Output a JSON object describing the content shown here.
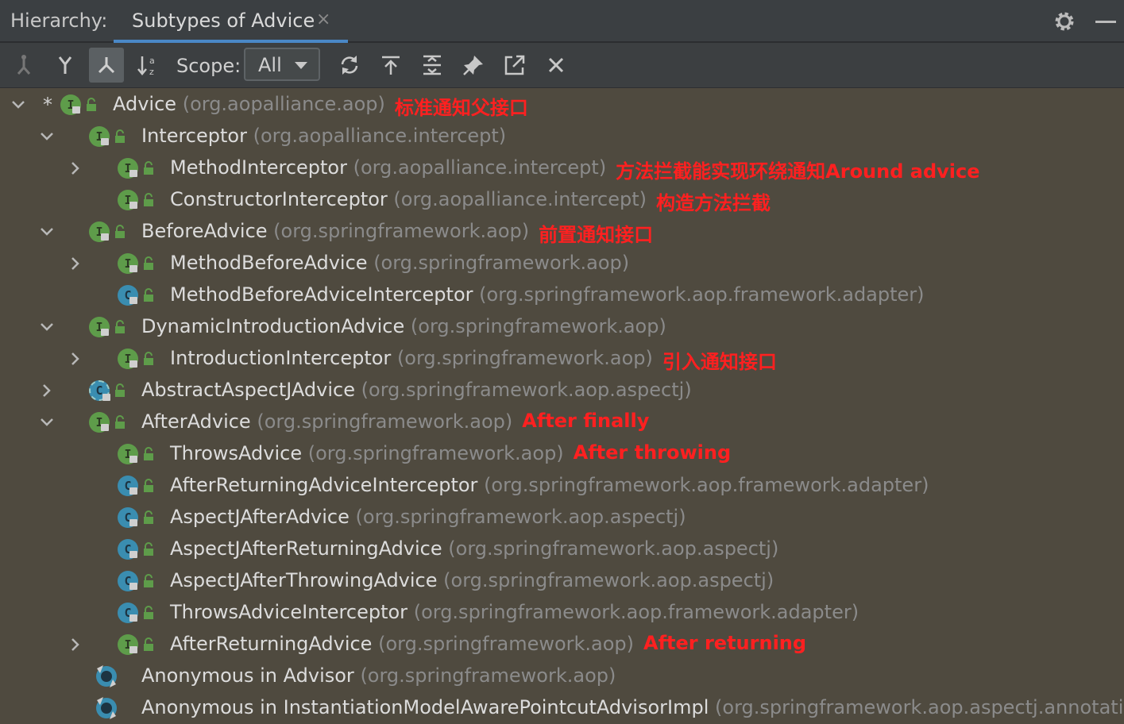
{
  "header": {
    "label": "Hierarchy:",
    "tab_title": "Subtypes of Advice",
    "tab_close": "×",
    "icons": [
      "gear-icon",
      "minimize-icon"
    ]
  },
  "toolbar": {
    "scope_label": "Scope:",
    "scope_value": "All",
    "icons": [
      "supertypes-hierarchy-icon",
      "subtypes-hierarchy-icon",
      "class-hierarchy-icon",
      "sort-alphabetically-icon",
      "refresh-icon",
      "export-icon",
      "expand-all-icon",
      "pin-icon",
      "open-in-new-window-icon",
      "close-icon"
    ]
  },
  "colors": {
    "background": "#4f4a3f",
    "annotation": "#ff2020",
    "interface": "#5e9c4a",
    "class": "#3a8db0",
    "tab_underline": "#4a88c7"
  },
  "tree": [
    {
      "name": "Advice",
      "package": "(org.aopalliance.aop)",
      "note": "标准通知父接口",
      "kind": "I",
      "star": "*",
      "chevron": "down"
    },
    {
      "name": "Interceptor",
      "package": "(org.aopalliance.intercept)",
      "note": "",
      "kind": "I",
      "chevron": "down"
    },
    {
      "name": "MethodInterceptor",
      "package": "(org.aopalliance.intercept)",
      "note": "方法拦截能实现环绕通知Around advice",
      "kind": "I",
      "chevron": "right"
    },
    {
      "name": "ConstructorInterceptor",
      "package": "(org.aopalliance.intercept)",
      "note": "构造方法拦截",
      "kind": "I",
      "chevron": ""
    },
    {
      "name": "BeforeAdvice",
      "package": "(org.springframework.aop)",
      "note": "前置通知接口",
      "kind": "I",
      "chevron": "down"
    },
    {
      "name": "MethodBeforeAdvice",
      "package": "(org.springframework.aop)",
      "note": "",
      "kind": "I",
      "chevron": "right"
    },
    {
      "name": "MethodBeforeAdviceInterceptor",
      "package": "(org.springframework.aop.framework.adapter)",
      "note": "",
      "kind": "C",
      "chevron": ""
    },
    {
      "name": "DynamicIntroductionAdvice",
      "package": "(org.springframework.aop)",
      "note": "",
      "kind": "I",
      "chevron": "down"
    },
    {
      "name": "IntroductionInterceptor",
      "package": "(org.springframework.aop)",
      "note": "引入通知接口",
      "kind": "I",
      "chevron": "right"
    },
    {
      "name": "AbstractAspectJAdvice",
      "package": "(org.springframework.aop.aspectj)",
      "note": "",
      "kind": "CA",
      "chevron": "right"
    },
    {
      "name": "AfterAdvice",
      "package": "(org.springframework.aop)",
      "note": "After finally",
      "kind": "I",
      "chevron": "down"
    },
    {
      "name": "ThrowsAdvice",
      "package": "(org.springframework.aop)",
      "note": "After throwing",
      "kind": "I",
      "chevron": ""
    },
    {
      "name": "AfterReturningAdviceInterceptor",
      "package": "(org.springframework.aop.framework.adapter)",
      "note": "",
      "kind": "C",
      "chevron": ""
    },
    {
      "name": "AspectJAfterAdvice",
      "package": "(org.springframework.aop.aspectj)",
      "note": "",
      "kind": "C",
      "chevron": ""
    },
    {
      "name": "AspectJAfterReturningAdvice",
      "package": "(org.springframework.aop.aspectj)",
      "note": "",
      "kind": "C",
      "chevron": ""
    },
    {
      "name": "AspectJAfterThrowingAdvice",
      "package": "(org.springframework.aop.aspectj)",
      "note": "",
      "kind": "C",
      "chevron": ""
    },
    {
      "name": "ThrowsAdviceInterceptor",
      "package": "(org.springframework.aop.framework.adapter)",
      "note": "",
      "kind": "C",
      "chevron": ""
    },
    {
      "name": "AfterReturningAdvice",
      "package": "(org.springframework.aop)",
      "note": "After returning",
      "kind": "I",
      "chevron": "right"
    },
    {
      "name": "Anonymous in Advisor",
      "package": "(org.springframework.aop)",
      "note": "",
      "kind": "anon",
      "chevron": ""
    },
    {
      "name": "Anonymous in InstantiationModelAwarePointcutAdvisorImpl",
      "package": "(org.springframework.aop.aspectj.annotation)",
      "note": "",
      "kind": "anon",
      "chevron": ""
    }
  ]
}
